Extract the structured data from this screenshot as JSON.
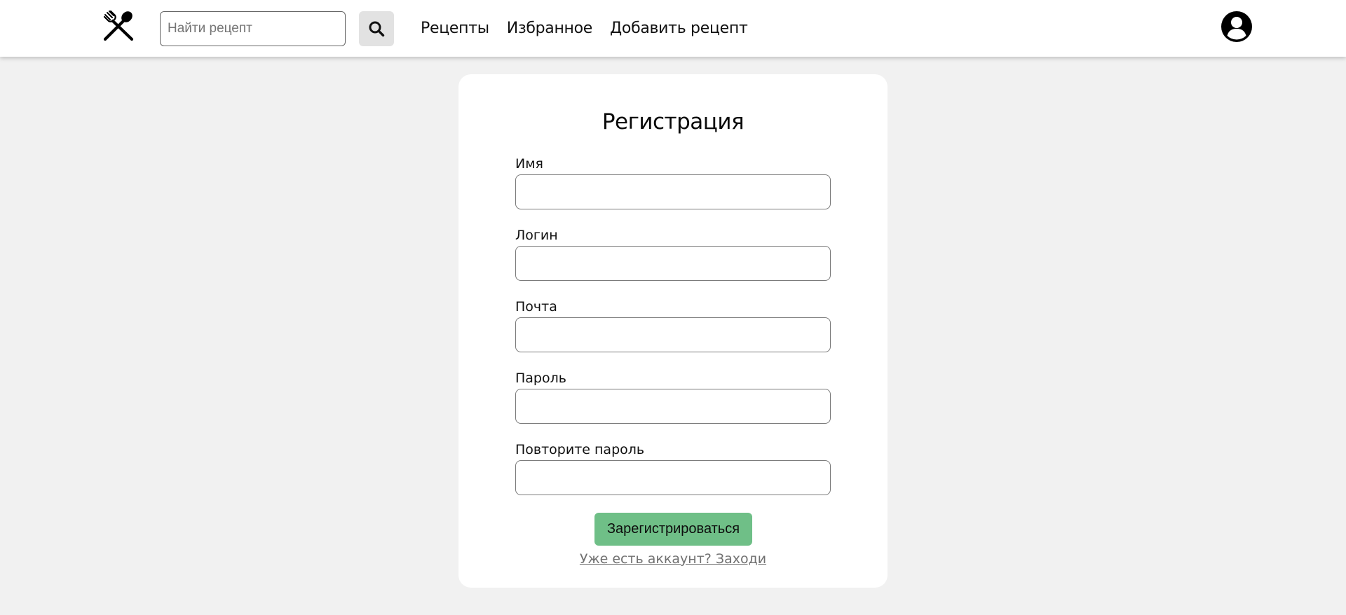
{
  "header": {
    "logo_icon": "fork-spoon-crossed-icon",
    "search": {
      "placeholder": "Найти рецепт",
      "value": "",
      "button_icon": "search-icon"
    },
    "nav": [
      {
        "label": "Рецепты"
      },
      {
        "label": "Избранное"
      },
      {
        "label": "Добавить рецепт"
      }
    ],
    "profile_icon": "user-circle-icon"
  },
  "form": {
    "title": "Регистрация",
    "fields": [
      {
        "label": "Имя",
        "value": ""
      },
      {
        "label": "Логин",
        "value": ""
      },
      {
        "label": "Почта",
        "value": ""
      },
      {
        "label": "Пароль",
        "value": ""
      },
      {
        "label": "Повторите пароль",
        "value": ""
      }
    ],
    "submit_label": "Зарегистрироваться",
    "login_link": "Уже есть аккаунт? Заходи"
  },
  "colors": {
    "background": "#f1f1f1",
    "card": "#ffffff",
    "accent_green": "#6fbf87",
    "search_button": "#e2e2e2",
    "link_gray": "#707070"
  }
}
